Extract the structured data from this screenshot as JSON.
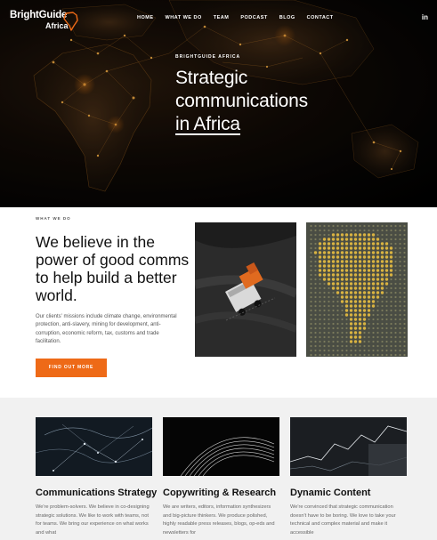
{
  "brand": {
    "line1": "BrightGuide",
    "line2": "Africa"
  },
  "nav": {
    "items": [
      "HOME",
      "WHAT WE DO",
      "TEAM",
      "PODCAST",
      "BLOG",
      "CONTACT"
    ],
    "social_label": "in"
  },
  "hero": {
    "eyebrow": "BRIGHTGUIDE AFRICA",
    "title_line1": "Strategic",
    "title_line2": "communications",
    "title_line3": "in Africa"
  },
  "what_we_do": {
    "eyebrow": "WHAT WE DO",
    "title": "We believe in the power of good comms to help build a better world.",
    "body": "Our clients' missions include climate change, environmental protection, anti-slavery, mining for development, anti-corruption, economic reform, tax, customs and trade facilitation.",
    "button_label": "FIND OUT MORE"
  },
  "services": [
    {
      "title": "Communications Strategy",
      "body": "We're problem-solvers. We believe in co-designing strategic solutions. We like to work with teams, not for teams. We bring our experience on what works and what"
    },
    {
      "title": "Copywriting & Research",
      "body": "We are writers, editors, information synthesizers and big-picture thinkers. We produce polished, highly readable press releases, blogs, op-eds and newsletters for"
    },
    {
      "title": "Dynamic Content",
      "body": "We're convinced that strategic communication doesn't have to be boring. We love to take your technical and complex material and make it accessible"
    }
  ],
  "colors": {
    "accent": "#ee6a17",
    "hero_dark": "#0a0705",
    "services_bg": "#f1f1f1"
  },
  "icons": {
    "logo_mark": "africa-outline-icon",
    "social": "linkedin-icon"
  }
}
